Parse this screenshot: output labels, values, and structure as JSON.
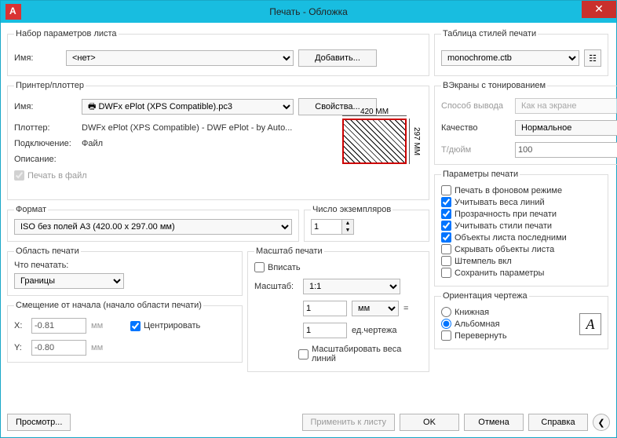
{
  "window": {
    "title": "Печать - Обложка"
  },
  "pageset": {
    "legend": "Набор параметров листа",
    "name_label": "Имя:",
    "name_value": "<нет>",
    "add_button": "Добавить..."
  },
  "printer": {
    "legend": "Принтер/плоттер",
    "name_label": "Имя:",
    "name_value": "DWFx ePlot (XPS Compatible).pc3",
    "properties_button": "Свойства...",
    "plotter_label": "Плоттер:",
    "plotter_value": "DWFx ePlot (XPS Compatible) - DWF ePlot - by Auto...",
    "connection_label": "Подключение:",
    "connection_value": "Файл",
    "description_label": "Описание:",
    "plot_to_file_label": "Печать в файл",
    "preview_top": "420 MM",
    "preview_right": "297 MM"
  },
  "format": {
    "legend": "Формат",
    "value": "ISO без полей A3 (420.00 x 297.00 мм)"
  },
  "copies": {
    "legend": "Число экземпляров",
    "value": "1"
  },
  "area": {
    "legend": "Область печати",
    "what_label": "Что печатать:",
    "what_value": "Границы"
  },
  "offset": {
    "legend": "Смещение от начала (начало области печати)",
    "x_label": "X:",
    "x_value": "-0.81",
    "y_label": "Y:",
    "y_value": "-0.80",
    "unit": "мм",
    "center_label": "Центрировать"
  },
  "scale": {
    "legend": "Масштаб печати",
    "fit_label": "Вписать",
    "scale_label": "Масштаб:",
    "scale_value": "1:1",
    "unit_value": "1",
    "unit_sel": "мм",
    "equals": "=",
    "drawing_value": "1",
    "drawing_unit": "ед.чертежа",
    "scale_weights_label": "Масштабировать веса линий"
  },
  "styles": {
    "legend": "Таблица стилей печати",
    "value": "monochrome.ctb"
  },
  "shade": {
    "legend": "ВЭкраны с тонированием",
    "method_label": "Способ вывода",
    "method_value": "Как на экране",
    "quality_label": "Качество",
    "quality_value": "Нормальное",
    "dpi_label": "Т/дюйм",
    "dpi_value": "100"
  },
  "options": {
    "legend": "Параметры печати",
    "items": [
      {
        "label": "Печать в фоновом режиме",
        "checked": false,
        "enabled": true
      },
      {
        "label": "Учитывать веса линий",
        "checked": true,
        "enabled": true
      },
      {
        "label": "Прозрачность при печати",
        "checked": true,
        "enabled": true
      },
      {
        "label": "Учитывать стили печати",
        "checked": true,
        "enabled": true
      },
      {
        "label": "Объекты листа последними",
        "checked": true,
        "enabled": true
      },
      {
        "label": "Скрывать объекты листа",
        "checked": false,
        "enabled": true
      },
      {
        "label": "Штемпель вкл",
        "checked": false,
        "enabled": true
      },
      {
        "label": "Сохранить параметры",
        "checked": false,
        "enabled": true
      }
    ]
  },
  "orientation": {
    "legend": "Ориентация чертежа",
    "portrait": "Книжная",
    "landscape": "Альбомная",
    "reverse": "Перевернуть",
    "selected": "landscape"
  },
  "buttons": {
    "preview": "Просмотр...",
    "apply": "Применить к листу",
    "ok": "OK",
    "cancel": "Отмена",
    "help": "Справка"
  }
}
